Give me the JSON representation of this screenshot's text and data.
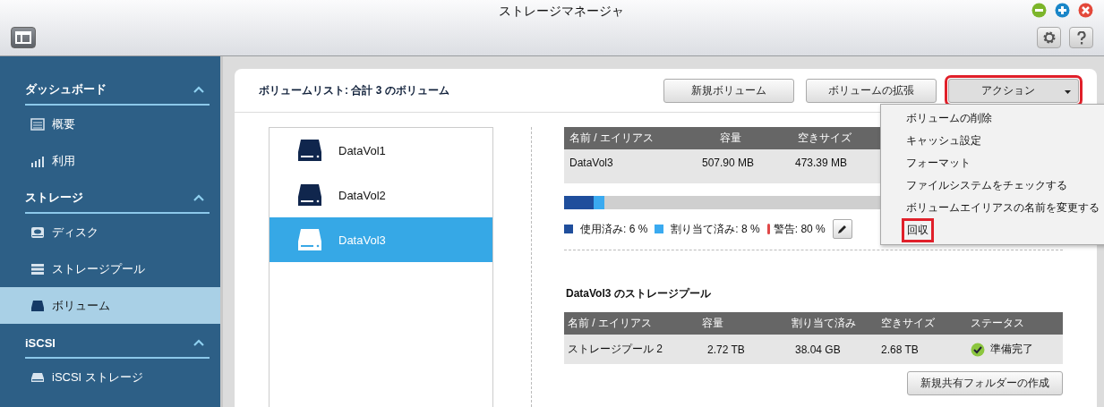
{
  "window": {
    "title": "ストレージマネージャ"
  },
  "sidebar": {
    "sections": [
      {
        "title": "ダッシュボード",
        "expanded": true,
        "items": [
          {
            "label": "概要",
            "kind": "overview",
            "selected": false
          },
          {
            "label": "利用",
            "kind": "chart",
            "selected": false
          }
        ]
      },
      {
        "title": "ストレージ",
        "expanded": true,
        "items": [
          {
            "label": "ディスク",
            "kind": "disk",
            "selected": false
          },
          {
            "label": "ストレージプール",
            "kind": "pool",
            "selected": false
          },
          {
            "label": "ボリューム",
            "kind": "volume",
            "selected": true
          }
        ]
      },
      {
        "title": "iSCSI",
        "expanded": true,
        "items": [
          {
            "label": "iSCSI ストレージ",
            "kind": "iscsi",
            "selected": false
          }
        ]
      }
    ]
  },
  "header": {
    "title": "ボリュームリスト: 合計 3 のボリューム",
    "buttons": [
      {
        "label": "新規ボリューム",
        "kind": "plain",
        "highlighted": false
      },
      {
        "label": "ボリュームの拡張",
        "kind": "plain",
        "highlighted": false
      },
      {
        "label": "アクション",
        "kind": "dropdown",
        "highlighted": true
      }
    ]
  },
  "volumes": [
    {
      "name": "DataVol1",
      "selected": false
    },
    {
      "name": "DataVol2",
      "selected": false
    },
    {
      "name": "DataVol3",
      "selected": true
    }
  ],
  "volume_table": {
    "columns": [
      "名前 / エイリアス",
      "容量",
      "空きサイズ"
    ],
    "rows": [
      [
        "DataVol3",
        "507.90 MB",
        "473.39 MB"
      ]
    ]
  },
  "usage": {
    "used": {
      "level": 0.06
    },
    "allocated": {
      "level": 0.08
    },
    "legend": [
      {
        "label": "使用済み: 6 %",
        "color": "#1f4e9c"
      },
      {
        "label": "割り当て済み: 8 %",
        "color": "#3aaaf0"
      },
      {
        "label": "警告: 80 %",
        "color": "#e04848"
      }
    ]
  },
  "action_menu": [
    {
      "label": "ボリュームの削除",
      "highlighted": false
    },
    {
      "label": "キャッシュ設定",
      "highlighted": false
    },
    {
      "label": "フォーマット",
      "highlighted": false
    },
    {
      "label": "ファイルシステムをチェックする",
      "highlighted": false
    },
    {
      "label": "ボリュームエイリアスの名前を変更する",
      "highlighted": false
    },
    {
      "label": "回収",
      "highlighted": true
    }
  ],
  "pool_section": {
    "title": "DataVol3 のストレージプール",
    "columns": [
      "名前 / エイリアス",
      "容量",
      "割り当て済み",
      "空きサイズ",
      "ステータス"
    ],
    "rows": [
      {
        "cells": [
          "ストレージプール 2",
          "2.72 TB",
          "38.04 GB",
          "2.68 TB"
        ],
        "status": "準備完了",
        "status_ok": true
      }
    ],
    "button": "新規共有フォルダーの作成"
  }
}
